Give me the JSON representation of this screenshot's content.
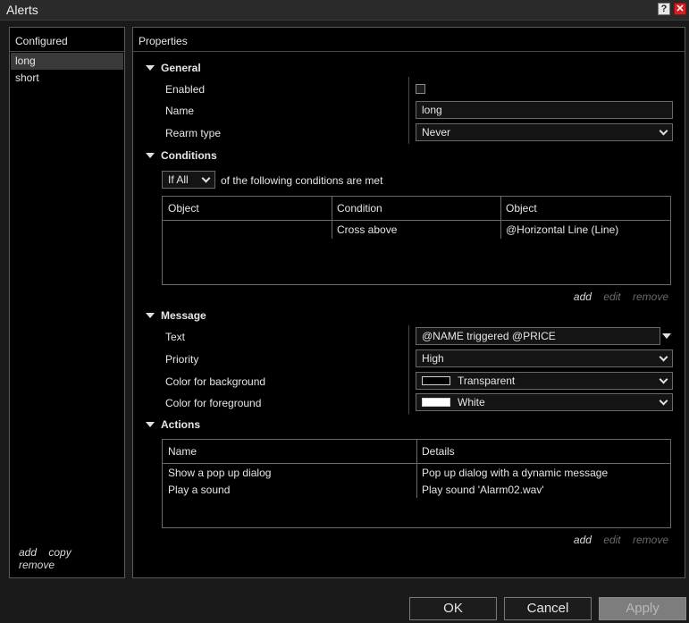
{
  "window": {
    "title": "Alerts",
    "help_label": "?",
    "close_label": "✕"
  },
  "configured": {
    "header": "Configured",
    "items": [
      {
        "label": "long",
        "selected": true
      },
      {
        "label": "short",
        "selected": false
      }
    ],
    "links": {
      "add": "add",
      "copy": "copy",
      "remove": "remove"
    }
  },
  "properties": {
    "header": "Properties",
    "general": {
      "title": "General",
      "enabled_label": "Enabled",
      "enabled": false,
      "name_label": "Name",
      "name_value": "long",
      "rearm_label": "Rearm type",
      "rearm_value": "Never"
    },
    "conditions": {
      "title": "Conditions",
      "mode_value": "If All",
      "mode_suffix": "of the following conditions are met",
      "columns": [
        "Object",
        "Condition",
        "Object"
      ],
      "rows": [
        [
          "",
          "Cross above",
          "@Horizontal Line (Line)"
        ]
      ],
      "links": {
        "add": "add",
        "edit": "edit",
        "remove": "remove"
      }
    },
    "message": {
      "title": "Message",
      "text_label": "Text",
      "text_value": "@NAME triggered @PRICE",
      "priority_label": "Priority",
      "priority_value": "High",
      "bg_label": "Color for background",
      "bg_value": "Transparent",
      "bg_color": "#000000",
      "fg_label": "Color for foreground",
      "fg_value": "White",
      "fg_color": "#ffffff"
    },
    "actions": {
      "title": "Actions",
      "columns": [
        "Name",
        "Details"
      ],
      "rows": [
        [
          "Show a pop up dialog",
          "Pop up dialog with a dynamic message"
        ],
        [
          "Play a sound",
          "Play sound 'Alarm02.wav'"
        ]
      ],
      "links": {
        "add": "add",
        "edit": "edit",
        "remove": "remove"
      }
    }
  },
  "buttons": {
    "ok": "OK",
    "cancel": "Cancel",
    "apply": "Apply"
  }
}
